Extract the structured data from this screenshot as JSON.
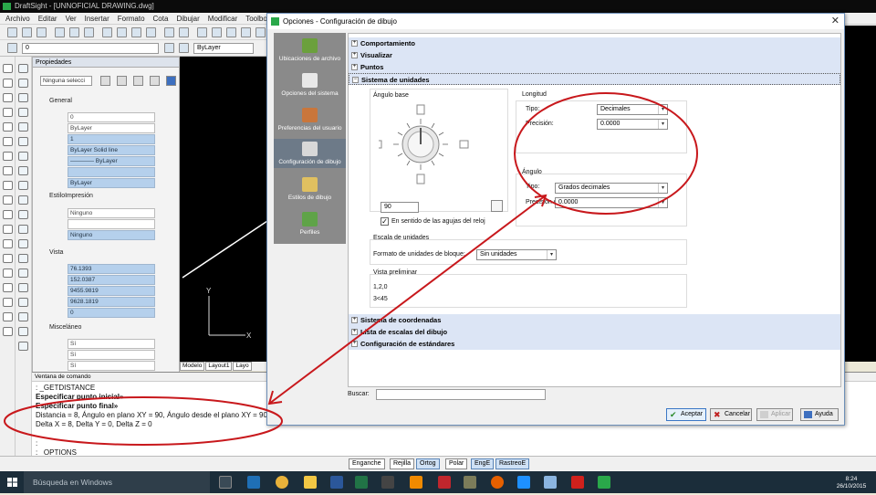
{
  "app": {
    "title": "DraftSight - [UNNOFICIAL DRAWING.dwg]",
    "menu": [
      "Archivo",
      "Editar",
      "Ver",
      "Insertar",
      "Formato",
      "Cota",
      "Dibujar",
      "Modificar",
      "Toolbox"
    ],
    "combo_layer": "0",
    "combo_color": "ByLayer"
  },
  "properties": {
    "title": "Propiedades",
    "selection": "Ninguna selecci",
    "general_label": "General",
    "general_rows": [
      "0",
      "ByLayer",
      "1",
      "ByLayer      Solid line",
      "———— ByLayer",
      "",
      "ByLayer"
    ],
    "print_label": "EstiloImpresión",
    "print_rows": [
      "Ninguno",
      "",
      "Ninguno"
    ],
    "view_label": "Vista",
    "view_rows": [
      "76.1393",
      "152.0387",
      "9455.9819",
      "9628.1819",
      "0"
    ],
    "misc_label": "Misceláneo",
    "misc_rows": [
      "Sí",
      "Sí",
      "Sí",
      "Sí"
    ]
  },
  "tabs": [
    "Modelo",
    "Layout1",
    "Layo"
  ],
  "command": {
    "title": "Ventana de comando",
    "lines": [
      {
        "text": ": _GETDISTANCE",
        "bold": false
      },
      {
        "text": "Especificar punto inicial»",
        "bold": true
      },
      {
        "text": "Especificar punto final»",
        "bold": true
      },
      {
        "text": "Distancia = 8, Ángulo en plano XY = 90, Ángulo desde el plano XY = 90",
        "bold": false
      },
      {
        "text": "Delta X = 8, Delta Y = 0, Delta Z = 0",
        "bold": false
      },
      {
        "text": ":",
        "bold": false
      },
      {
        "text": ": _OPTIONS",
        "bold": false
      }
    ]
  },
  "status_buttons": [
    "Enganche",
    "Rejilla",
    "Ortog",
    "Polar",
    "EngE",
    "RastreoE"
  ],
  "taskbar": {
    "search": "Búsqueda en Windows",
    "time": "8:24",
    "date": "26/10/2015"
  },
  "dialog": {
    "title": "Opciones - Configuración de dibujo",
    "sidebar": [
      {
        "label": "Ubicaciones de archivo",
        "icon": "folder-icon",
        "active": false
      },
      {
        "label": "Opciones del sistema",
        "icon": "system-options-icon",
        "active": false
      },
      {
        "label": "Preferencias del usuario",
        "icon": "user-preferences-icon",
        "active": false
      },
      {
        "label": "Configuración de dibujo",
        "icon": "drawing-settings-icon",
        "active": true
      },
      {
        "label": "Estilos de dibujo",
        "icon": "drawing-styles-icon",
        "active": false
      },
      {
        "label": "Perfiles",
        "icon": "profiles-icon",
        "active": false
      }
    ],
    "tree_top": [
      "Comportamiento",
      "Visualizar",
      "Puntos",
      "Sistema de unidades"
    ],
    "tree_bottom": [
      "Sistema de coordenadas",
      "Lista de escalas del dibujo",
      "Configuración de estándares"
    ],
    "base_angle": {
      "label": "Ángulo base",
      "value": "90",
      "clockwise_label": "En sentido de las agujas del reloj",
      "clockwise_checked": true
    },
    "length": {
      "label": "Longitud",
      "type_label": "Tipo:",
      "type_value": "Decimales",
      "precision_label": "Precisión:",
      "precision_value": "0.0000"
    },
    "angle": {
      "label": "Ángulo",
      "type_label": "Tipo:",
      "type_value": "Grados decimales",
      "precision_label": "Precisión de:",
      "precision_value": "0.0000"
    },
    "unit_scale": {
      "label": "Escala de unidades",
      "format_label": "Formato de unidades de bloque:",
      "format_value": "Sin unidades"
    },
    "preview": {
      "label": "Vista preliminar",
      "line1": "1,2,0",
      "line2": "3<45"
    },
    "search_label": "Buscar:",
    "buttons": {
      "accept": "Aceptar",
      "cancel": "Cancelar",
      "apply": "Aplicar",
      "help": "Ayuda"
    }
  },
  "colors": {
    "annotation_red": "#c8181c",
    "tree_row": "#dce5f5",
    "sidebar": "#8a8a8a"
  }
}
